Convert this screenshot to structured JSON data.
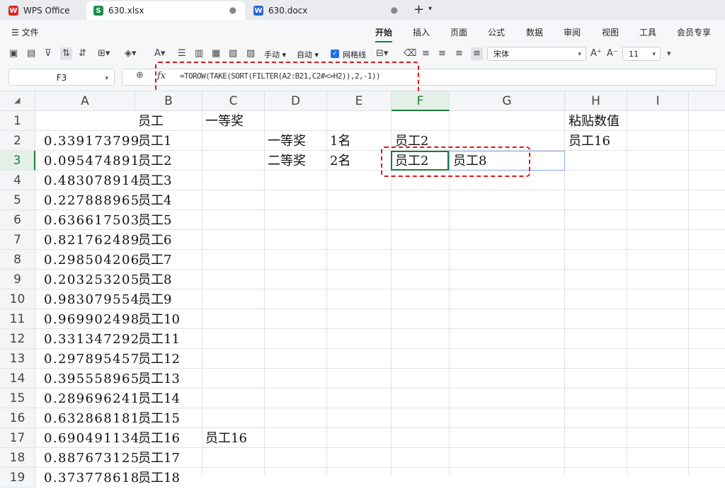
{
  "tabs": {
    "wps": "WPS Office",
    "xlsx": "630.xlsx",
    "docx": "630.docx",
    "add": "+",
    "more": "▾",
    "dot": "●",
    "xlsx_icon": "S",
    "docx_icon": "W",
    "wps_icon": "W"
  },
  "menu": {
    "file": "☰ 文件",
    "tabs": [
      "开始",
      "插入",
      "页面",
      "公式",
      "数据",
      "审阅",
      "视图",
      "工具",
      "会员专享"
    ]
  },
  "toolbar": {
    "manual": "手动",
    "auto": "自动",
    "gridlines": "网格线",
    "font": "宋体",
    "font_size": "11"
  },
  "formula_bar": {
    "cell_ref": "F3",
    "fx": "fx",
    "formula": "=TOROW(TAKE(SORT(FILTER(A2:B21,C2#<>H2)),2,-1))"
  },
  "columns": [
    "A",
    "B",
    "C",
    "D",
    "E",
    "F",
    "G",
    "H",
    "I"
  ],
  "rows": [
    "1",
    "2",
    "3",
    "4",
    "5",
    "6",
    "7",
    "8",
    "9",
    "10",
    "11",
    "12",
    "13",
    "14",
    "15",
    "16",
    "17",
    "18",
    "19"
  ],
  "cells": {
    "B1": "员工",
    "C1": "一等奖",
    "H1": "粘贴数值",
    "D2": "一等奖",
    "E2": "1名",
    "F2": "员工2",
    "H2": "员工16",
    "D3": "二等奖",
    "E3": "2名",
    "F3": "员工2",
    "G3": "员工8",
    "C17": "员工16",
    "colA": [
      "0.339173799",
      "0.095474891",
      "0.483078914",
      "0.227888965",
      "0.636617503",
      "0.821762489",
      "0.298504206",
      "0.203253205",
      "0.983079554",
      "0.969902498",
      "0.331347292",
      "0.297895457",
      "0.395558965",
      "0.289696241",
      "0.632868181",
      "0.690491134",
      "0.887673125",
      "0.373778618"
    ],
    "colB": [
      "员工1",
      "员工2",
      "员工3",
      "员工4",
      "员工5",
      "员工6",
      "员工7",
      "员工8",
      "员工9",
      "员工10",
      "员工11",
      "员工12",
      "员工13",
      "员工14",
      "员工15",
      "员工16",
      "员工17",
      "员工18"
    ]
  },
  "colors": {
    "accent": "#1a7f3c",
    "highlight": "#e0151c",
    "spill": "#7fa8e6"
  }
}
